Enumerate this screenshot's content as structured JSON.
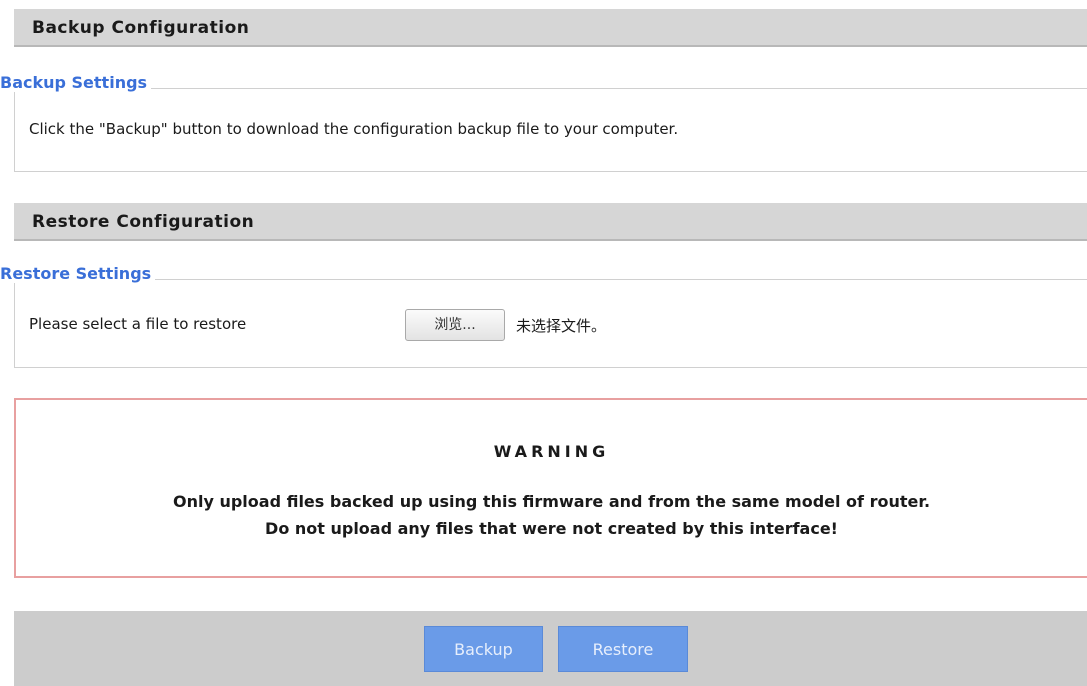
{
  "backup_section": {
    "header": "Backup Configuration",
    "legend": "Backup Settings",
    "description": "Click the \"Backup\" button to download the configuration backup file to your computer."
  },
  "restore_section": {
    "header": "Restore Configuration",
    "legend": "Restore Settings",
    "file_label": "Please select a file to restore",
    "browse_button": "浏览...",
    "file_status": "未选择文件。"
  },
  "warning": {
    "title": "WARNING",
    "line1": "Only upload files backed up using this firmware and from the same model of router.",
    "line2": "Do not upload any files that were not created by this interface!"
  },
  "footer": {
    "backup_button": "Backup",
    "restore_button": "Restore"
  },
  "colors": {
    "header_bg": "#d6d6d6",
    "legend_text": "#3a6fd8",
    "warning_border": "#e8a0a0",
    "button_bg": "#6a9be8",
    "footer_bg": "#cccccc"
  }
}
